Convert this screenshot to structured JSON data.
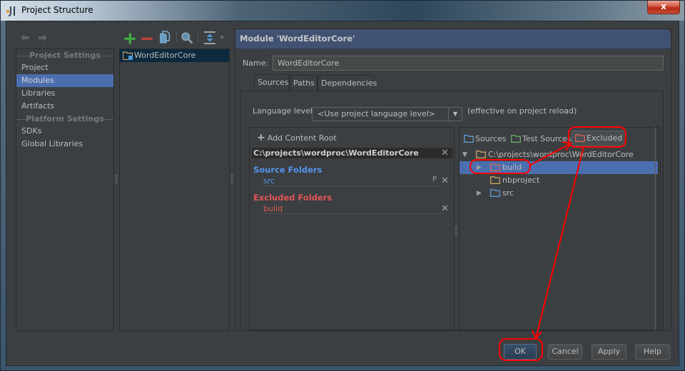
{
  "window": {
    "title": "Project Structure",
    "close_label": "x"
  },
  "nav": {
    "back_icon": "arrow-left-icon",
    "forward_icon": "arrow-right-icon"
  },
  "sidebar": {
    "sections": [
      {
        "title": "Project Settings",
        "items": [
          {
            "label": "Project",
            "selected": false
          },
          {
            "label": "Modules",
            "selected": true
          },
          {
            "label": "Libraries",
            "selected": false
          },
          {
            "label": "Artifacts",
            "selected": false
          }
        ]
      },
      {
        "title": "Platform Settings",
        "items": [
          {
            "label": "SDKs",
            "selected": false
          },
          {
            "label": "Global Libraries",
            "selected": false
          }
        ]
      }
    ]
  },
  "module_toolbar": {
    "icons": [
      "add-icon",
      "remove-icon",
      "copy-icon",
      "search-icon",
      "expand-collapse-icon",
      "more-icon"
    ],
    "more_label": "»"
  },
  "modules": [
    {
      "label": "WordEditorCore",
      "selected": true
    }
  ],
  "detail": {
    "header": "Module 'WordEditorCore'",
    "name_label": "Name:",
    "name_value": "WordEditorCore",
    "tabs": [
      {
        "label": "Sources",
        "active": true
      },
      {
        "label": "Paths",
        "active": false
      },
      {
        "label": "Dependencies",
        "active": false
      }
    ],
    "language_level_label": "Language level:",
    "language_level_value": "<Use project language level>",
    "language_level_note": "(effective on project reload)",
    "content_roots": {
      "add_label": "Add Content Root",
      "root_path": "C:\\projects\\wordproc\\WordEditorCore",
      "source_folders_title": "Source Folders",
      "source_folders": [
        {
          "name": "src",
          "prefix_icon": "P"
        }
      ],
      "excluded_folders_title": "Excluded Folders",
      "excluded_folders": [
        {
          "name": "build"
        }
      ]
    },
    "mark_as": {
      "sources_label": "Sources",
      "test_sources_label": "Test Sources",
      "excluded_label": "Excluded",
      "excluded_pressed": true
    },
    "tree": {
      "root": "C:\\projects\\wordproc\\WordEditorCore",
      "children": [
        {
          "label": "build",
          "type": "excluded",
          "expandable": true,
          "selected": true
        },
        {
          "label": "nbproject",
          "type": "plain",
          "expandable": false,
          "selected": false
        },
        {
          "label": "src",
          "type": "source",
          "expandable": true,
          "selected": false
        }
      ]
    }
  },
  "buttons": {
    "ok": "OK",
    "cancel": "Cancel",
    "apply": "Apply",
    "help": "Help"
  },
  "colors": {
    "selection": "#4b6eaf",
    "source_folder": "#5394ec",
    "excluded_folder": "#e05555",
    "annotation": "#ff0000",
    "header_bg": "#415172"
  }
}
